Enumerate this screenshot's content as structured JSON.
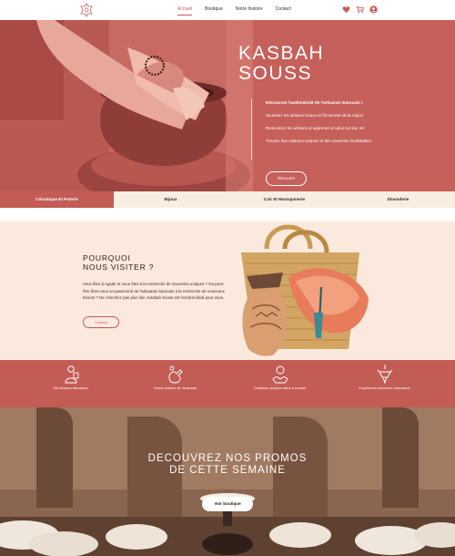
{
  "nav": {
    "links": [
      "Accueil",
      "Boutique",
      "Notre histoire",
      "Contact"
    ],
    "active_index": 0,
    "icons": [
      "heart-icon",
      "cart-icon",
      "user-icon"
    ]
  },
  "hero": {
    "title_line1": "KASBAH",
    "title_line2": "SOUSS",
    "lead": "Découvrez l'authenticité de l'artisanat marocain !",
    "lines": [
      "Soutenez les artisans locaux et l'économie de la région",
      "Rencontrez les artisans et apprenez-en plus sur leur art",
      "Trouvez des cadeaux uniques et des souvenirs inoubliables"
    ],
    "button": "Découvrir"
  },
  "tabs": {
    "items": [
      "Céramique Et Poterie",
      "Bijoux",
      "Cuir Et Maroquinerie",
      "Dinanderie"
    ],
    "active_index": 0
  },
  "about": {
    "title_line1": "POURQUOI",
    "title_line2": "NOUS VISITER ?",
    "text": "Vous êtes à Agadir et vous êtes à la recherche de souvenirs uniques ? Ou peut-être êtes-vous un passionné de l'artisanat marocain à la recherche de nouveaux trésors ? Ne cherchez pas plus loin, Kasbah Souss est l'endroit idéal pour vous.",
    "button": "Contact"
  },
  "features": [
    {
      "label": "+60 artisans talentueux",
      "icon": "artisan-icon"
    },
    {
      "label": "Divers métiers de l'artisanat",
      "icon": "crafts-icon"
    },
    {
      "label": "Créations uniques faites à la main",
      "icon": "handmade-icon"
    },
    {
      "label": "Expérience immersive marocaine",
      "icon": "chandelier-icon"
    }
  ],
  "promo": {
    "title_line1": "DECOUVREZ NOS PROMOS",
    "title_line2": "DE CETTE SEMAINE",
    "button": "Voir boutique"
  },
  "colors": {
    "accent": "#c25c55",
    "cream": "#fbe9dd",
    "tab_bg": "#faeee3"
  }
}
